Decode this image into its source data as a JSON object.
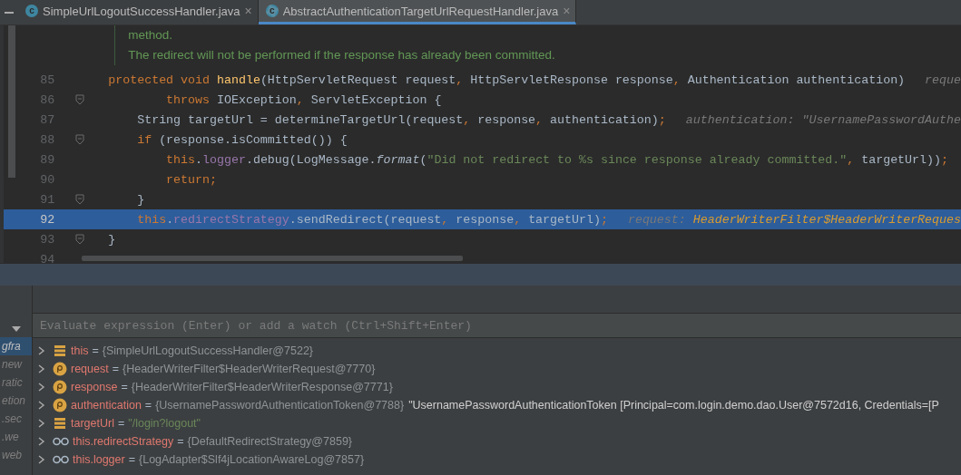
{
  "tabs": [
    {
      "label": "SimpleUrlLogoutSuccessHandler.java",
      "badge": "c",
      "kind": "class",
      "selected": false,
      "close": "×"
    },
    {
      "label": "AbstractAuthenticationTargetUrlRequestHandler.java",
      "badge": "c",
      "kind": "abstract",
      "selected": true,
      "close": "×"
    }
  ],
  "editor": {
    "doc_comment": [
      "method.",
      "The redirect will not be performed if the response has already been committed."
    ],
    "lines": [
      {
        "number": "85",
        "fold": false,
        "selected": false,
        "tokens": [
          {
            "kind": "keyword",
            "text": "protected void "
          },
          {
            "kind": "decl",
            "text": "handle"
          },
          {
            "kind": "plain",
            "text": "(HttpServletRequest request"
          },
          {
            "kind": "keyword",
            "text": ", "
          },
          {
            "kind": "plain",
            "text": "HttpServletResponse response"
          },
          {
            "kind": "keyword",
            "text": ", "
          },
          {
            "kind": "plain",
            "text": "Authentication authentication)"
          },
          {
            "kind": "hint",
            "text": "reque"
          }
        ]
      },
      {
        "number": "86",
        "fold": true,
        "selected": false,
        "tokens": [
          {
            "kind": "keyword",
            "text": "        throws "
          },
          {
            "kind": "plain",
            "text": "IOException"
          },
          {
            "kind": "keyword",
            "text": ", "
          },
          {
            "kind": "plain",
            "text": "ServletException {"
          }
        ]
      },
      {
        "number": "87",
        "fold": false,
        "selected": false,
        "tokens": [
          {
            "kind": "plain",
            "text": "    String targetUrl = determineTargetUrl(request"
          },
          {
            "kind": "keyword",
            "text": ", "
          },
          {
            "kind": "plain",
            "text": "response"
          },
          {
            "kind": "keyword",
            "text": ", "
          },
          {
            "kind": "plain",
            "text": "authentication)"
          },
          {
            "kind": "keyword",
            "text": ";"
          },
          {
            "kind": "hint",
            "text": "authentication: \"UsernamePasswordAuthe"
          }
        ]
      },
      {
        "number": "88",
        "fold": true,
        "selected": false,
        "tokens": [
          {
            "kind": "keyword",
            "text": "    if "
          },
          {
            "kind": "plain",
            "text": "(response.isCommitted()) {"
          }
        ]
      },
      {
        "number": "89",
        "fold": false,
        "selected": false,
        "tokens": [
          {
            "kind": "keyword",
            "text": "        this"
          },
          {
            "kind": "plain",
            "text": "."
          },
          {
            "kind": "field",
            "text": "logger"
          },
          {
            "kind": "plain",
            "text": ".debug(LogMessage."
          },
          {
            "kind": "static",
            "text": "format"
          },
          {
            "kind": "plain",
            "text": "("
          },
          {
            "kind": "string",
            "text": "\"Did not redirect to %s since response already committed.\""
          },
          {
            "kind": "keyword",
            "text": ", "
          },
          {
            "kind": "plain",
            "text": "targetUrl))"
          },
          {
            "kind": "keyword",
            "text": ";"
          }
        ]
      },
      {
        "number": "90",
        "fold": false,
        "selected": false,
        "tokens": [
          {
            "kind": "keyword",
            "text": "        return;"
          }
        ]
      },
      {
        "number": "91",
        "fold": true,
        "selected": false,
        "tokens": [
          {
            "kind": "plain",
            "text": "    }"
          }
        ]
      },
      {
        "number": "92",
        "fold": false,
        "selected": true,
        "tokens": [
          {
            "kind": "keyword",
            "text": "    this"
          },
          {
            "kind": "plain",
            "text": "."
          },
          {
            "kind": "field",
            "text": "redirectStrategy"
          },
          {
            "kind": "plain",
            "text": ".sendRedirect(request"
          },
          {
            "kind": "keyword",
            "text": ", "
          },
          {
            "kind": "plain",
            "text": "response"
          },
          {
            "kind": "keyword",
            "text": ", "
          },
          {
            "kind": "plain",
            "text": "targetUrl)"
          },
          {
            "kind": "keyword",
            "text": ";"
          },
          {
            "kind": "hint",
            "text": "request: "
          },
          {
            "kind": "hint_value",
            "text": "HeaderWriterFilter$HeaderWriterReques"
          }
        ]
      },
      {
        "number": "93",
        "fold": true,
        "selected": false,
        "tokens": [
          {
            "kind": "plain",
            "text": "}"
          }
        ]
      },
      {
        "number": "94",
        "fold": false,
        "selected": false
      }
    ]
  },
  "debugger": {
    "frames": [
      {
        "label": "gfra",
        "selected": true
      },
      {
        "label": "new",
        "selected": false
      },
      {
        "label": "ratic",
        "selected": false
      },
      {
        "label": "etion",
        "selected": false
      },
      {
        "label": ".sec",
        "selected": false
      },
      {
        "label": ".we",
        "selected": false
      },
      {
        "label": "web",
        "selected": false
      }
    ],
    "watch_field": {
      "placeholder": "Evaluate expression (Enter) or add a watch (Ctrl+Shift+Enter)"
    },
    "variables": [
      {
        "kind": "field",
        "name": "this",
        "equals": "=",
        "value": "{SimpleUrlLogoutSuccessHandler@7522}"
      },
      {
        "kind": "param",
        "name": "request",
        "equals": "=",
        "value": "{HeaderWriterFilter$HeaderWriterRequest@7770}"
      },
      {
        "kind": "param",
        "name": "response",
        "equals": "=",
        "value": "{HeaderWriterFilter$HeaderWriterResponse@7771}"
      },
      {
        "kind": "param",
        "name": "authentication",
        "equals": "=",
        "value": "{UsernamePasswordAuthenticationToken@7788}",
        "text": "\"UsernamePasswordAuthenticationToken [Principal=com.login.demo.dao.User@7572d16, Credentials=[P"
      },
      {
        "kind": "field",
        "name": "targetUrl",
        "equals": "=",
        "string": "\"/login?logout\""
      },
      {
        "kind": "watch",
        "name": "this.redirectStrategy",
        "equals": "=",
        "value": "{DefaultRedirectStrategy@7859}"
      },
      {
        "kind": "watch",
        "name": "this.logger",
        "equals": "=",
        "value": "{LogAdapter$Slf4jLocationAwareLog@7857}"
      }
    ]
  }
}
